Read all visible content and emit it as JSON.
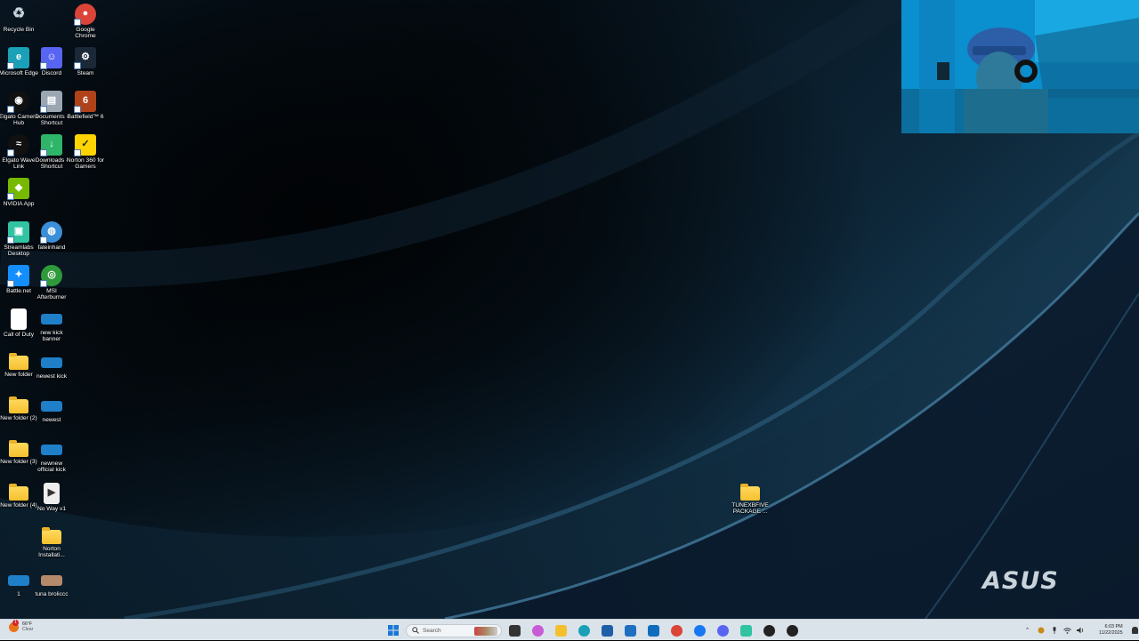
{
  "desktop": {
    "icons": [
      {
        "label": "Recycle Bin",
        "icon": "recycle-bin-icon",
        "color": "#9aa8b4"
      },
      {
        "label": "Google Chrome",
        "icon": "chrome-icon",
        "color": "#db4437"
      },
      {
        "label": "Microsoft Edge",
        "icon": "edge-icon",
        "color": "#1aa1b8"
      },
      {
        "label": "Discord",
        "icon": "discord-icon",
        "color": "#5865f2"
      },
      {
        "label": "Steam",
        "icon": "steam-icon",
        "color": "#1b2838"
      },
      {
        "label": "Elgato Camera Hub",
        "icon": "elgato-camera-icon",
        "color": "#111111"
      },
      {
        "label": "Documents - Shortcut",
        "icon": "documents-icon",
        "color": "#9aa6b2"
      },
      {
        "label": "Battlefield™ 6",
        "icon": "battlefield-icon",
        "color": "#b0421a"
      },
      {
        "label": "Elgato Wave Link",
        "icon": "elgato-wave-icon",
        "color": "#111111"
      },
      {
        "label": "Downloads - Shortcut",
        "icon": "downloads-icon",
        "color": "#2fb56a"
      },
      {
        "label": "Norton 360 for Gamers",
        "icon": "norton-icon",
        "color": "#ffd400"
      },
      {
        "label": "NVIDIA App",
        "icon": "nvidia-icon",
        "color": "#76b900"
      },
      {
        "label": "Streamlabs Desktop",
        "icon": "streamlabs-icon",
        "color": "#31c3a2"
      },
      {
        "label": "fateinhand",
        "icon": "globe-icon",
        "color": "#3a8fd8"
      },
      {
        "label": "Battle.net",
        "icon": "battlenet-icon",
        "color": "#148eff"
      },
      {
        "label": "MSI Afterburner",
        "icon": "msi-afterburner-icon",
        "color": "#2f9a3a"
      },
      {
        "label": "Call of Duty",
        "icon": "file-icon",
        "color": "#ffffff"
      },
      {
        "label": "new kick banner",
        "icon": "image-file-icon",
        "color": "#1f7fc8"
      },
      {
        "label": "New folder",
        "icon": "folder-icon",
        "color": "#f5c02f"
      },
      {
        "label": "newest kick",
        "icon": "image-file-icon",
        "color": "#1f7fc8"
      },
      {
        "label": "New folder (2)",
        "icon": "folder-icon",
        "color": "#f5c02f"
      },
      {
        "label": "newest",
        "icon": "image-file-icon",
        "color": "#1f7fc8"
      },
      {
        "label": "New folder (3)",
        "icon": "folder-icon",
        "color": "#f5c02f"
      },
      {
        "label": "newnew official kick",
        "icon": "image-file-icon",
        "color": "#1f7fc8"
      },
      {
        "label": "New folder (4)",
        "icon": "folder-icon",
        "color": "#f5c02f"
      },
      {
        "label": "No Way v1",
        "icon": "video-file-icon",
        "color": "#eeeeee"
      },
      {
        "label": "Norton Installati...",
        "icon": "folder-icon",
        "color": "#f5c02f"
      },
      {
        "label": "1",
        "icon": "image-file-icon",
        "color": "#1f7fc8"
      },
      {
        "label": "tuna broliccc",
        "icon": "image-file-icon",
        "color": "#b48a6a"
      },
      {
        "label": "TUNEXBFIVE PACKAGE ...",
        "icon": "folder-icon",
        "color": "#f5c02f"
      }
    ]
  },
  "wallpaper": {
    "brand": "ASUS"
  },
  "taskbar": {
    "weather": {
      "temp": "66°F",
      "condition": "Clear",
      "badge": "1"
    },
    "search_placeholder": "Search",
    "pinned": [
      {
        "icon": "start-icon",
        "color": "#1a78d4"
      },
      {
        "icon": "task-view-icon",
        "color": "#333333"
      },
      {
        "icon": "copilot-icon",
        "color": "#c85bd6"
      },
      {
        "icon": "file-explorer-icon",
        "color": "#f5c02f"
      },
      {
        "icon": "edge-icon",
        "color": "#1aa1b8"
      },
      {
        "icon": "store-icon",
        "color": "#1f5fa8"
      },
      {
        "icon": "vscode-icon",
        "color": "#1e6fc0"
      },
      {
        "icon": "outlook-icon",
        "color": "#0f6cbd"
      },
      {
        "icon": "chrome-icon",
        "color": "#db4437"
      },
      {
        "icon": "facebook-icon",
        "color": "#1877f2"
      },
      {
        "icon": "discord-icon",
        "color": "#5865f2"
      },
      {
        "icon": "streamlabs-icon",
        "color": "#31c3a2"
      },
      {
        "icon": "app-icon",
        "color": "#222222"
      },
      {
        "icon": "elgato-icon",
        "color": "#222222"
      }
    ],
    "clock": {
      "time": "6:03 PM",
      "date": "11/22/2025"
    }
  }
}
